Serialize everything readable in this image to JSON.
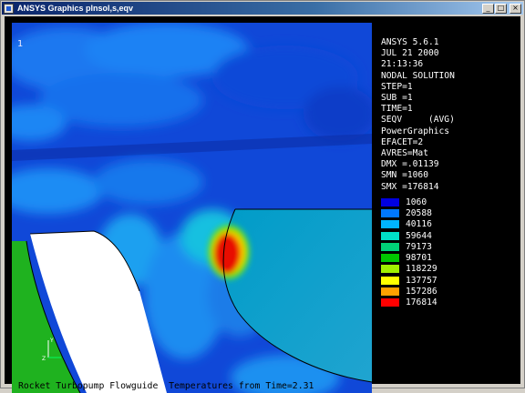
{
  "window": {
    "title": "ANSYS Graphics   plnsol,s,eqv",
    "buttons": {
      "minimize": "_",
      "maximize": "□",
      "close": "×"
    }
  },
  "viewport": {
    "number": "1"
  },
  "info": [
    "ANSYS 5.6.1",
    "JUL 21 2000",
    "21:13:36",
    "NODAL SOLUTION",
    "STEP=1",
    "SUB =1",
    "TIME=1",
    "SEQV     (AVG)",
    "PowerGraphics",
    "EFACET=2",
    "AVRES=Mat",
    "DMX =.01139",
    "SMN =1060",
    "SMX =176814"
  ],
  "contour_legend": [
    {
      "value": "1060",
      "color": "#0000e0"
    },
    {
      "value": "20588",
      "color": "#0078ff"
    },
    {
      "value": "40116",
      "color": "#00b4ff"
    },
    {
      "value": "59644",
      "color": "#00e0c8"
    },
    {
      "value": "79173",
      "color": "#00d278"
    },
    {
      "value": "98701",
      "color": "#00c800"
    },
    {
      "value": "118229",
      "color": "#a0f000"
    },
    {
      "value": "137757",
      "color": "#ffff00"
    },
    {
      "value": "157286",
      "color": "#ffa000"
    },
    {
      "value": "176814",
      "color": "#ff0000"
    }
  ],
  "caption": "Rocket Turbopump Flowguide  Temperatures from Time=2.31",
  "triad": {
    "y_label": "Y",
    "z_label": "Z"
  }
}
